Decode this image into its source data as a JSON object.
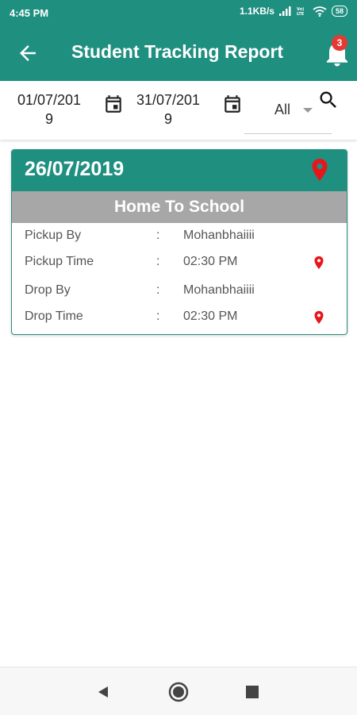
{
  "status_bar": {
    "time": "4:45 PM",
    "network_speed": "1.1KB/s",
    "battery": "58"
  },
  "app_bar": {
    "title": "Student Tracking Report",
    "notification_count": "3"
  },
  "filters": {
    "from_date_line1": "01/07/201",
    "from_date_line2": "9",
    "to_date_line1": "31/07/201",
    "to_date_line2": "9",
    "type_selected": "All"
  },
  "record": {
    "date": "26/07/2019",
    "route": "Home To School",
    "rows": [
      {
        "label": "Pickup By",
        "value": "Mohanbhaiiii",
        "location_icon": false
      },
      {
        "label": "Pickup Time",
        "value": "02:30 PM",
        "location_icon": true
      },
      {
        "label": "Drop By",
        "value": "Mohanbhaiiii",
        "location_icon": false
      },
      {
        "label": "Drop Time",
        "value": "02:30 PM",
        "location_icon": true
      }
    ],
    "separator": ":"
  },
  "colors": {
    "primary": "#1f8f80",
    "subheader": "#a7a7a7",
    "pin": "#e8161b"
  }
}
